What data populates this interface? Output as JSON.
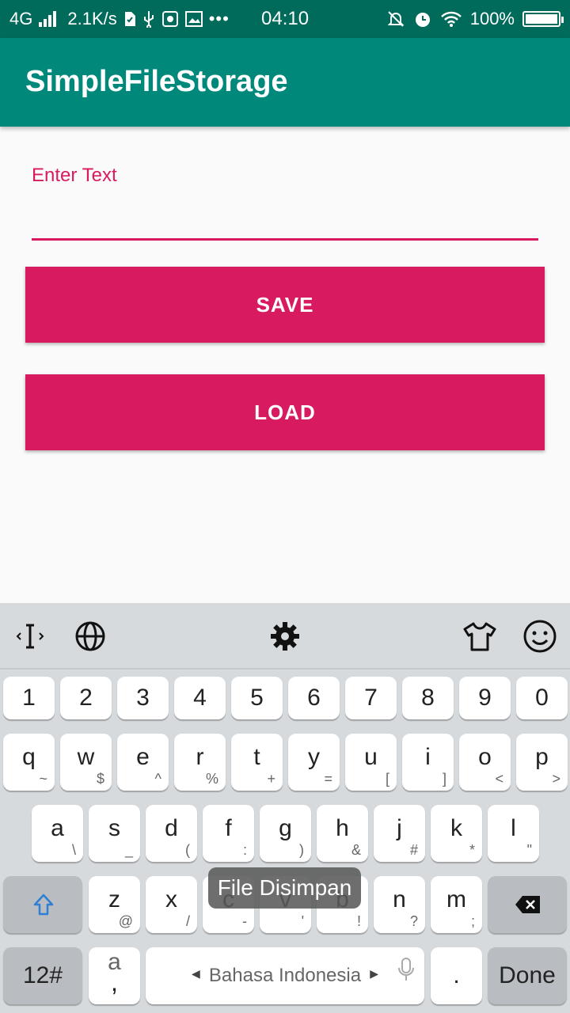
{
  "status_bar": {
    "network": "4G",
    "speed": "2.1K/s",
    "time": "04:10",
    "battery_text": "100%",
    "battery_level": 1.0,
    "icons": [
      "signal-icon",
      "sim-icon",
      "usb-icon",
      "app-icon",
      "gallery-icon",
      "more-icon",
      "silent-bell-icon",
      "alarm-icon",
      "wifi-icon",
      "battery-icon"
    ]
  },
  "app_bar": {
    "title": "SimpleFileStorage",
    "color": "#00897b"
  },
  "form": {
    "label": "Enter Text",
    "input_value": "",
    "accent": "#d81b60",
    "save_label": "SAVE",
    "load_label": "LOAD"
  },
  "toast": {
    "text": "File Disimpan"
  },
  "keyboard": {
    "toolbar_icons": [
      "cursor-icon",
      "globe-icon",
      "settings-icon",
      "theme-icon",
      "emoji-icon"
    ],
    "numbers": [
      "1",
      "2",
      "3",
      "4",
      "5",
      "6",
      "7",
      "8",
      "9",
      "0"
    ],
    "row1": [
      {
        "k": "q",
        "s": "~"
      },
      {
        "k": "w",
        "s": "$"
      },
      {
        "k": "e",
        "s": "^"
      },
      {
        "k": "r",
        "s": "%"
      },
      {
        "k": "t",
        "s": "+"
      },
      {
        "k": "y",
        "s": "="
      },
      {
        "k": "u",
        "s": "["
      },
      {
        "k": "i",
        "s": "]"
      },
      {
        "k": "o",
        "s": "<"
      },
      {
        "k": "p",
        "s": ">"
      }
    ],
    "row2": [
      {
        "k": "a",
        "s": "\\"
      },
      {
        "k": "s",
        "s": "_"
      },
      {
        "k": "d",
        "s": "("
      },
      {
        "k": "f",
        "s": ":"
      },
      {
        "k": "g",
        "s": ")"
      },
      {
        "k": "h",
        "s": "&"
      },
      {
        "k": "j",
        "s": "#"
      },
      {
        "k": "k",
        "s": "*"
      },
      {
        "k": "l",
        "s": "\""
      }
    ],
    "row3": [
      {
        "k": "z",
        "s": "@"
      },
      {
        "k": "x",
        "s": "/"
      },
      {
        "k": "c",
        "s": "-"
      },
      {
        "k": "v",
        "s": "'"
      },
      {
        "k": "b",
        "s": "!"
      },
      {
        "k": "n",
        "s": "?"
      },
      {
        "k": "m",
        "s": ";"
      }
    ],
    "symbols_label": "12#",
    "comma_top": "a",
    "comma_label": ",",
    "space_label": "Bahasa Indonesia",
    "period_label": ".",
    "done_label": "Done"
  }
}
